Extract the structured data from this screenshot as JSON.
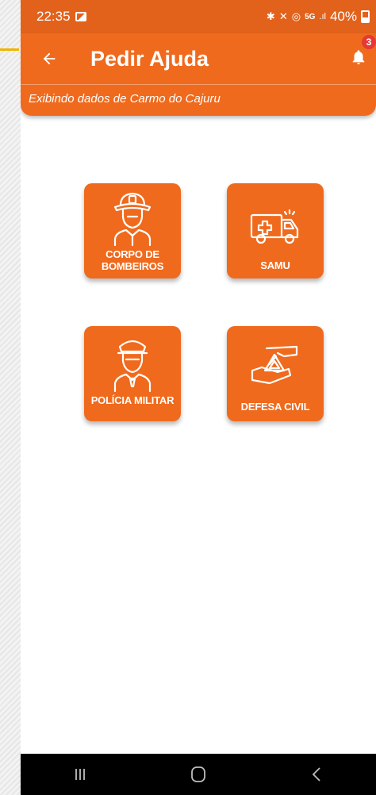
{
  "status_bar": {
    "time": "22:35",
    "battery_percent": "40%",
    "icons": [
      "image-icon",
      "bluetooth-icon",
      "mute-icon",
      "hotspot-icon",
      "5g-icon",
      "signal-icon",
      "battery-icon"
    ]
  },
  "header": {
    "title": "Pedir Ajuda",
    "subtitle": "Exibindo dados de Carmo do Cajuru",
    "notification_count": "3"
  },
  "services": [
    {
      "label_line1": "CORPO DE",
      "label_line2": "BOMBEIROS",
      "icon": "firefighter-icon"
    },
    {
      "label_line1": "SAMU",
      "label_line2": "",
      "icon": "ambulance-icon"
    },
    {
      "label_line1": "POLÍCIA MILITAR",
      "label_line2": "",
      "icon": "police-officer-icon"
    },
    {
      "label_line1": "DEFESA CIVIL",
      "label_line2": "",
      "icon": "civil-defense-icon"
    }
  ],
  "colors": {
    "primary": "#ef6a1d",
    "status_bar": "#e2621c",
    "badge": "#e53935",
    "nav_bar": "#000000",
    "accent_line": "#f0b400"
  }
}
